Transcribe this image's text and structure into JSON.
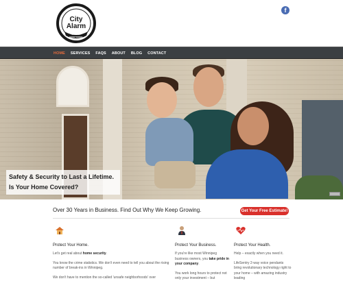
{
  "brand": {
    "logo_line1": "City",
    "logo_line2": "Alarm",
    "logo_sub1": "24 HOUR",
    "logo_sub2": "MONITORING"
  },
  "social": {
    "facebook_icon": "facebook-icon",
    "facebook_label": "f"
  },
  "nav": {
    "items": [
      {
        "label": "HOME",
        "active": true
      },
      {
        "label": "SERVICES",
        "active": false
      },
      {
        "label": "FAQS",
        "active": false
      },
      {
        "label": "ABOUT",
        "active": false
      },
      {
        "label": "BLOG",
        "active": false
      },
      {
        "label": "CONTACT",
        "active": false
      }
    ]
  },
  "hero": {
    "caption_line1": "Safety & Security to Last a Lifetime.",
    "caption_line2": "Is Your Home Covered?"
  },
  "intro": {
    "tagline": "Over 30 Years in Business. Find Out Why We Keep Growing.",
    "cta_label": "Get Your Free Estimate!"
  },
  "features": [
    {
      "icon": "house-icon",
      "title": "Protect Your Home.",
      "p1_pre": "Let's get real about ",
      "p1_bold": "home security",
      "p1_post": ".",
      "p2": "You know the crime statistics. We don't even need to tell you about the rising number of break-ins in Winnipeg.",
      "p3": "We don't have to mention the so-called 'unsafe neighborhoods' over"
    },
    {
      "icon": "businessman-icon",
      "title": "Protect Your Business.",
      "p1_pre": "If you're like most Winnipeg business owners, you ",
      "p1_bold": "take pride in your company",
      "p1_post": ".",
      "p2": "You work long hours to protect not only your investment – but"
    },
    {
      "icon": "heart-icon",
      "title": "Protect Your Health.",
      "p1": "Help – exactly when you need it.",
      "p2": "LifeSentry 2-way voice pendants bring revolutionary technology right to your home – with amazing industry leading"
    }
  ],
  "colors": {
    "nav_bg": "#3b3f42",
    "nav_active": "#e46b3c",
    "cta_bg": "#d9302b",
    "facebook": "#4a6cb3"
  }
}
